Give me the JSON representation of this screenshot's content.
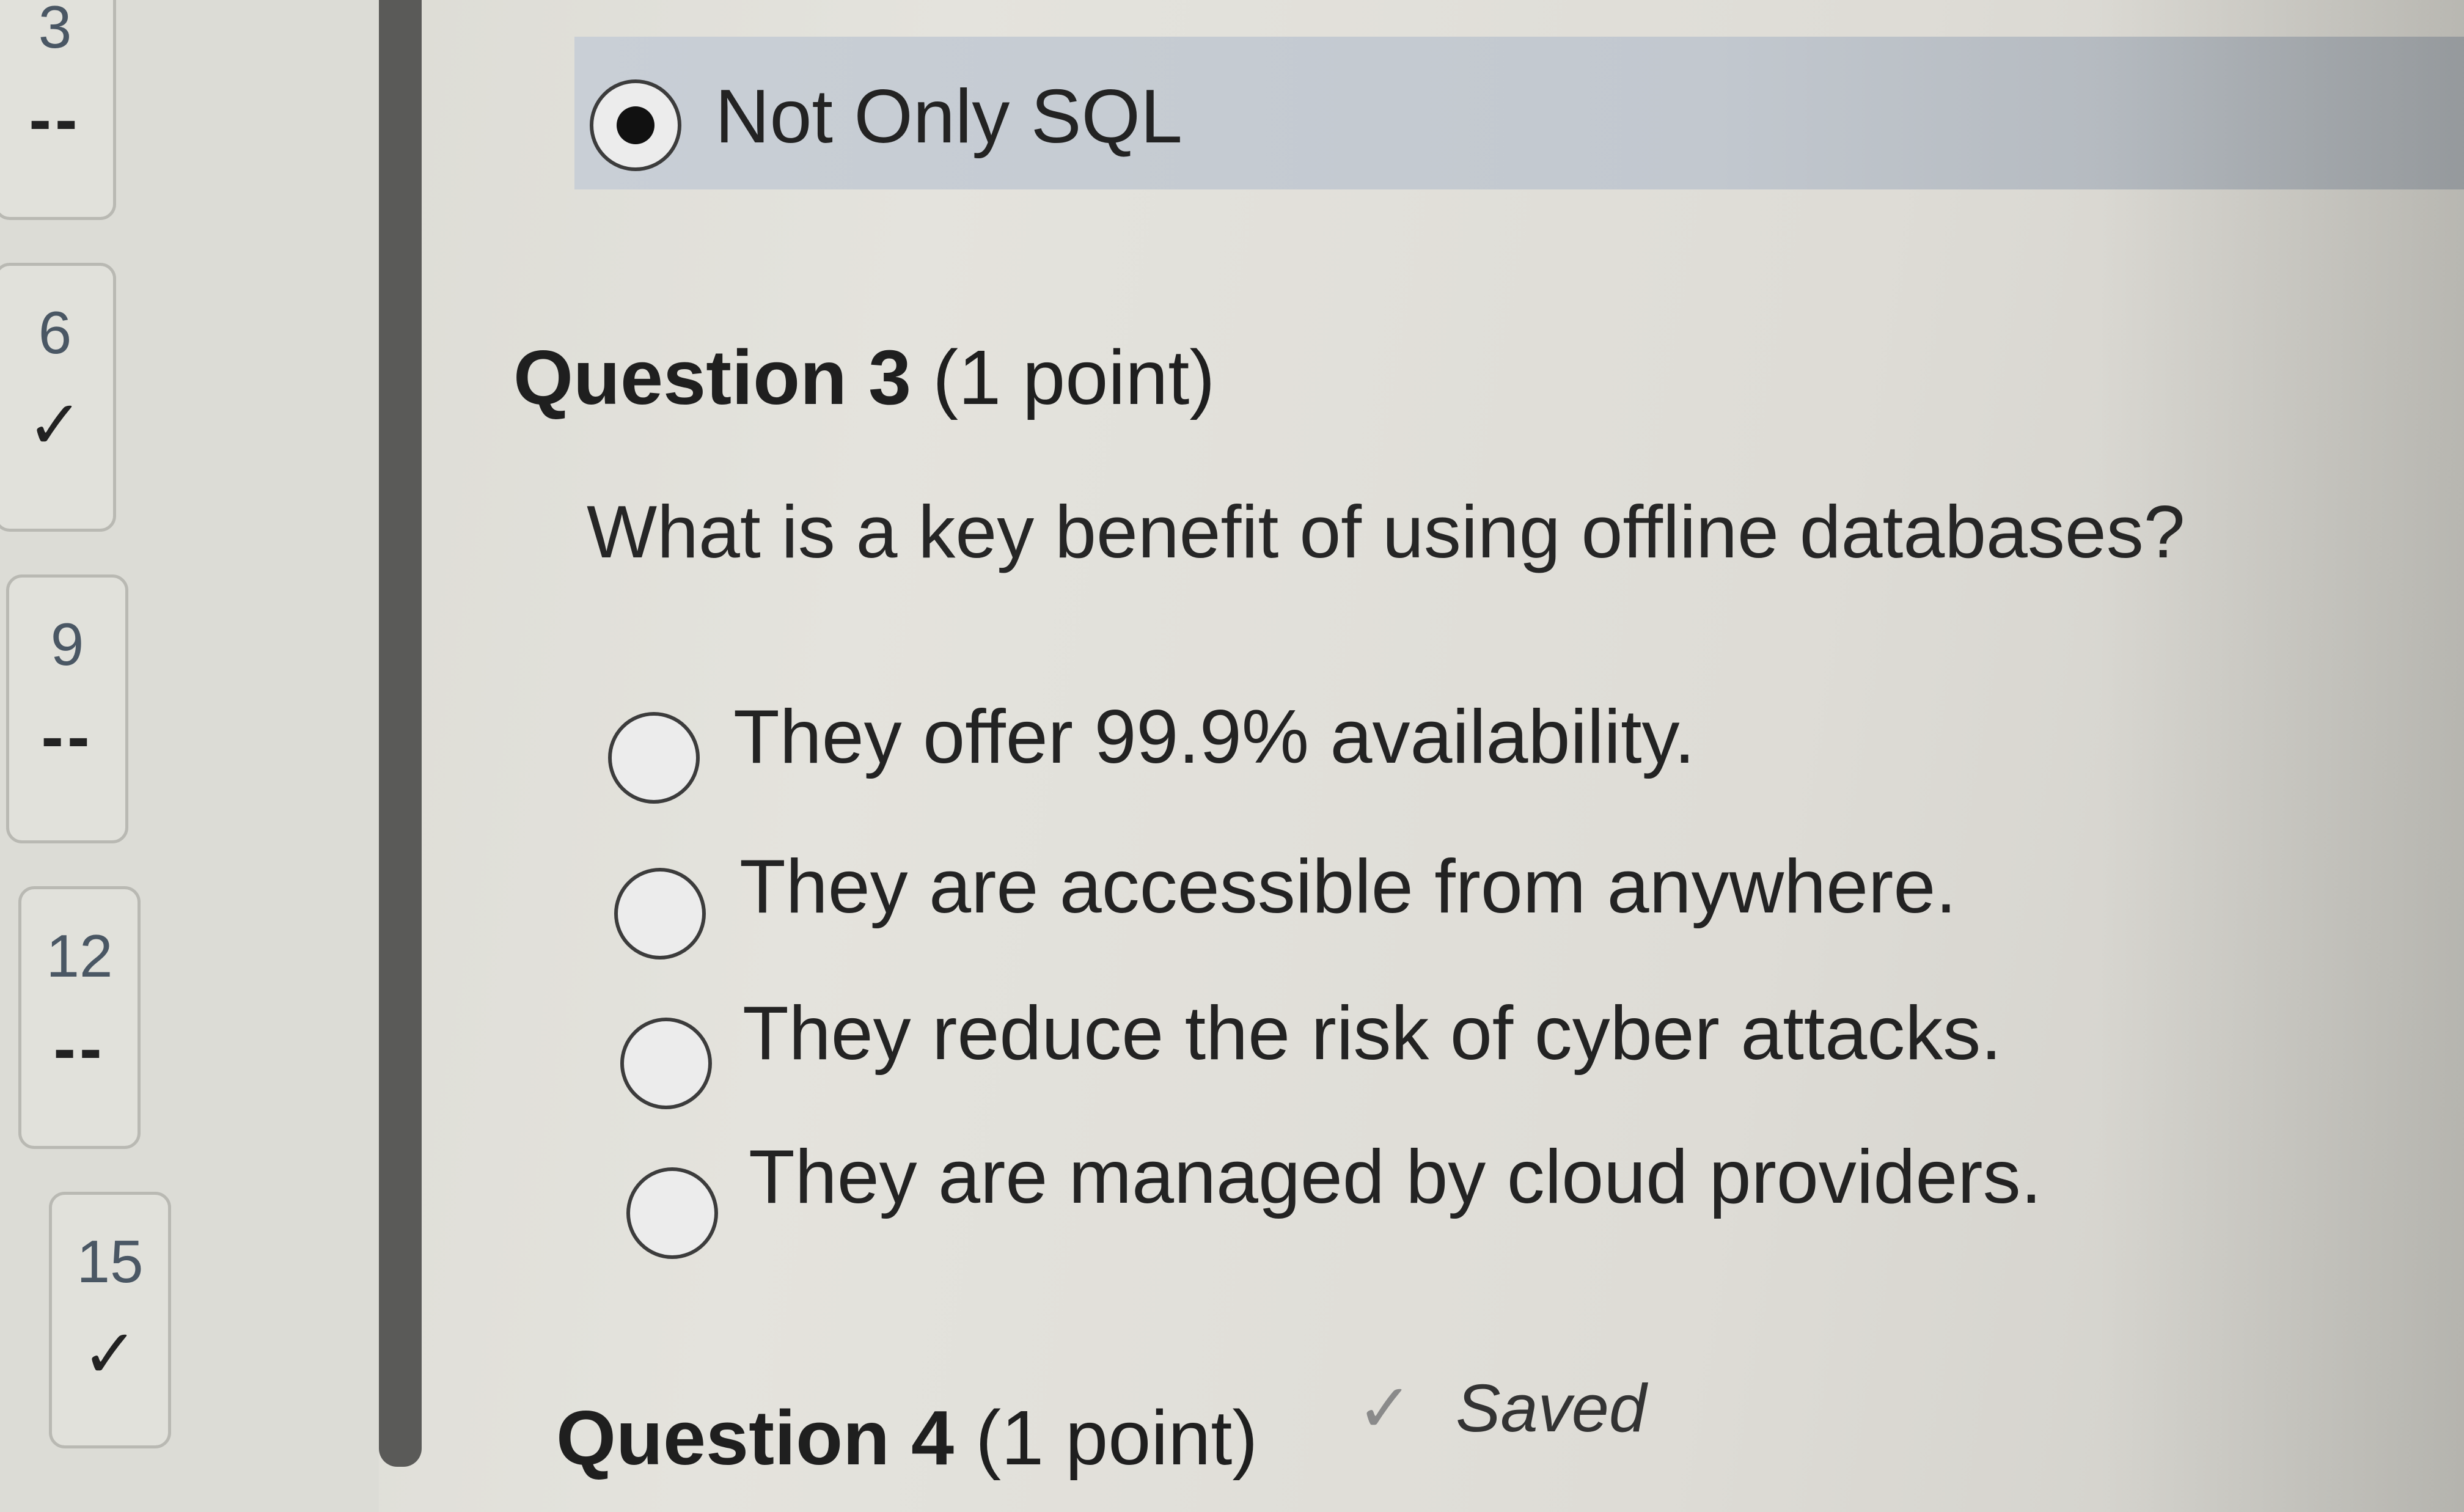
{
  "nav": {
    "items": [
      {
        "number": "3",
        "status": "--"
      },
      {
        "number": "6",
        "status": "✓"
      },
      {
        "number": "9",
        "status": "--"
      },
      {
        "number": "12",
        "status": "--"
      },
      {
        "number": "15",
        "status": "✓"
      }
    ]
  },
  "previous_question": {
    "selected_option": "Not Only SQL"
  },
  "question3": {
    "label": "Question 3",
    "points": "(1 point)",
    "text": "What is a key benefit of using offline databases?",
    "options": [
      "They offer 99.9% availability.",
      "They are accessible from anywhere.",
      "They reduce the risk of cyber attacks.",
      "They are managed by cloud providers."
    ]
  },
  "question4": {
    "label": "Question 4",
    "points": "(1 point)",
    "saved_label": "Saved"
  }
}
